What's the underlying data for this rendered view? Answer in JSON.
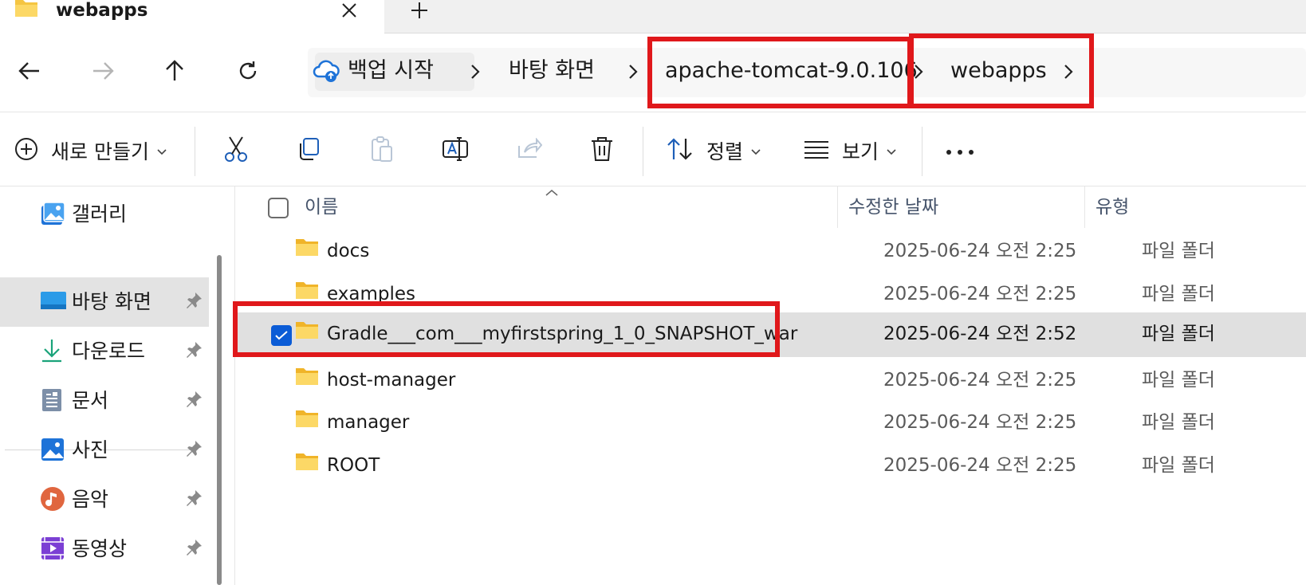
{
  "tab": {
    "title": "webapps"
  },
  "breadcrumb": {
    "backup": "백업 시작",
    "items": [
      "바탕 화면",
      "apache-tomcat-9.0.106",
      "webapps"
    ]
  },
  "toolbar": {
    "new_label": "새로 만들기",
    "sort_label": "정렬",
    "view_label": "보기"
  },
  "sidebar": {
    "items": [
      {
        "label": "갤러리",
        "icon": "gallery-icon",
        "pinned": false
      },
      {
        "label": "바탕 화면",
        "icon": "desktop-icon",
        "pinned": true,
        "active": true
      },
      {
        "label": "다운로드",
        "icon": "download-icon",
        "pinned": true
      },
      {
        "label": "문서",
        "icon": "document-icon",
        "pinned": true
      },
      {
        "label": "사진",
        "icon": "pictures-icon",
        "pinned": true
      },
      {
        "label": "음악",
        "icon": "music-icon",
        "pinned": true
      },
      {
        "label": "동영상",
        "icon": "video-icon",
        "pinned": true
      }
    ]
  },
  "columns": {
    "name": "이름",
    "modified": "수정한 날짜",
    "type": "유형"
  },
  "files": [
    {
      "name": "docs",
      "modified": "2025-06-24 오전 2:25",
      "type": "파일 폴더"
    },
    {
      "name": "examples",
      "modified": "2025-06-24 오전 2:25",
      "type": "파일 폴더"
    },
    {
      "name": "Gradle___com___myfirstspring_1_0_SNAPSHOT_war",
      "modified": "2025-06-24 오전 2:52",
      "type": "파일 폴더",
      "selected": true
    },
    {
      "name": "host-manager",
      "modified": "2025-06-24 오전 2:25",
      "type": "파일 폴더"
    },
    {
      "name": "manager",
      "modified": "2025-06-24 오전 2:25",
      "type": "파일 폴더"
    },
    {
      "name": "ROOT",
      "modified": "2025-06-24 오전 2:25",
      "type": "파일 폴더"
    }
  ],
  "colors": {
    "highlight": "#e0181b",
    "accent": "#0b5cd6",
    "folder": "#f5c542"
  }
}
